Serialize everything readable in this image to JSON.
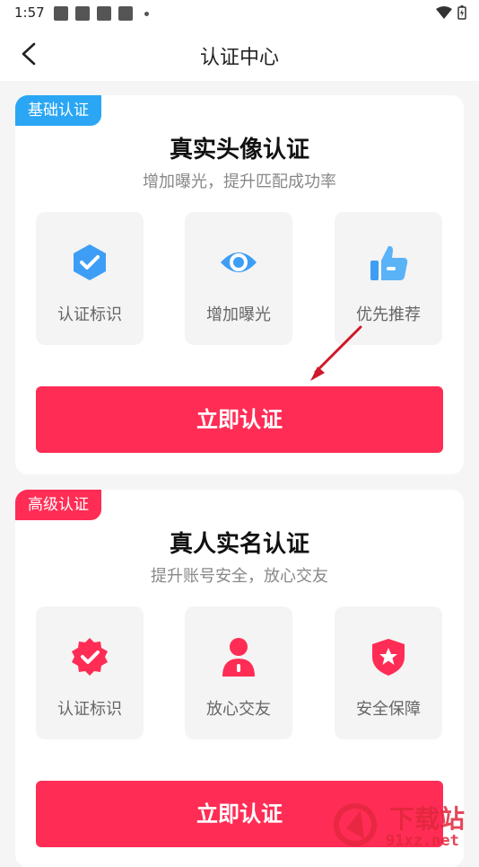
{
  "status": {
    "time": "1:57"
  },
  "nav": {
    "title": "认证中心"
  },
  "basic": {
    "tag": "基础认证",
    "title": "真实头像认证",
    "subtitle": "增加曝光，提升匹配成功率",
    "features": [
      {
        "label": "认证标识",
        "icon": "shield-check-icon"
      },
      {
        "label": "增加曝光",
        "icon": "eye-icon"
      },
      {
        "label": "优先推荐",
        "icon": "thumbs-up-icon"
      }
    ],
    "button": "立即认证"
  },
  "advanced": {
    "tag": "高级认证",
    "title": "真人实名认证",
    "subtitle": "提升账号安全，放心交友",
    "features": [
      {
        "label": "认证标识",
        "icon": "badge-check-icon"
      },
      {
        "label": "放心交友",
        "icon": "person-icon"
      },
      {
        "label": "安全保障",
        "icon": "shield-star-icon"
      }
    ],
    "button": "立即认证"
  },
  "watermark": {
    "brand": "下载站",
    "url": "91xz.net"
  },
  "colors": {
    "accent": "#ff2d55",
    "blue": "#2aa6f5"
  }
}
